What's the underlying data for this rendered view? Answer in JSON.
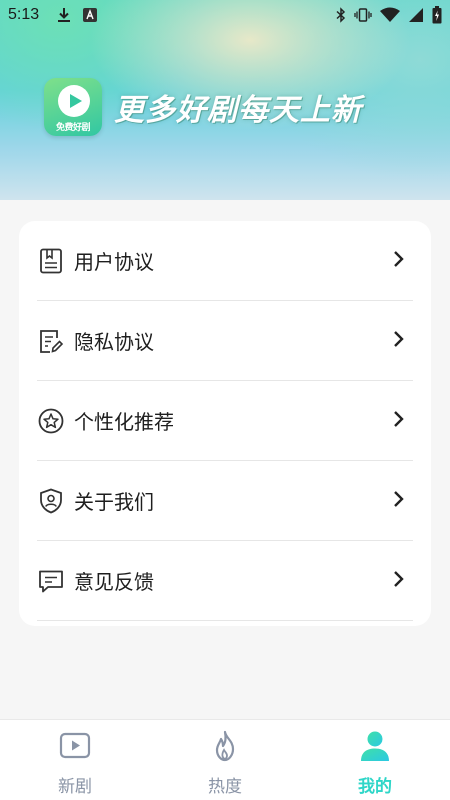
{
  "status_bar": {
    "time": "5:13",
    "left_icons": [
      "download-icon",
      "a-notification-icon"
    ],
    "right_icons": [
      "bluetooth-icon",
      "vibrate-icon",
      "wifi-icon",
      "signal-icon",
      "battery-icon"
    ]
  },
  "header": {
    "logo_text": "免费好剧",
    "slogan": "更多好剧每天上新"
  },
  "menu": {
    "items": [
      {
        "label": "用户协议",
        "icon": "document-icon"
      },
      {
        "label": "隐私协议",
        "icon": "edit-document-icon"
      },
      {
        "label": "个性化推荐",
        "icon": "star-icon"
      },
      {
        "label": "关于我们",
        "icon": "shield-user-icon"
      },
      {
        "label": "意见反馈",
        "icon": "chat-bubble-icon"
      }
    ]
  },
  "tab_bar": {
    "tabs": [
      {
        "label": "新剧",
        "icon": "play-icon",
        "active": false
      },
      {
        "label": "热度",
        "icon": "flame-icon",
        "active": false
      },
      {
        "label": "我的",
        "icon": "person-icon",
        "active": true
      }
    ]
  },
  "colors": {
    "accent": "#2fd6c8",
    "inactive": "#8a94a6",
    "background": "#f6f6f6"
  }
}
